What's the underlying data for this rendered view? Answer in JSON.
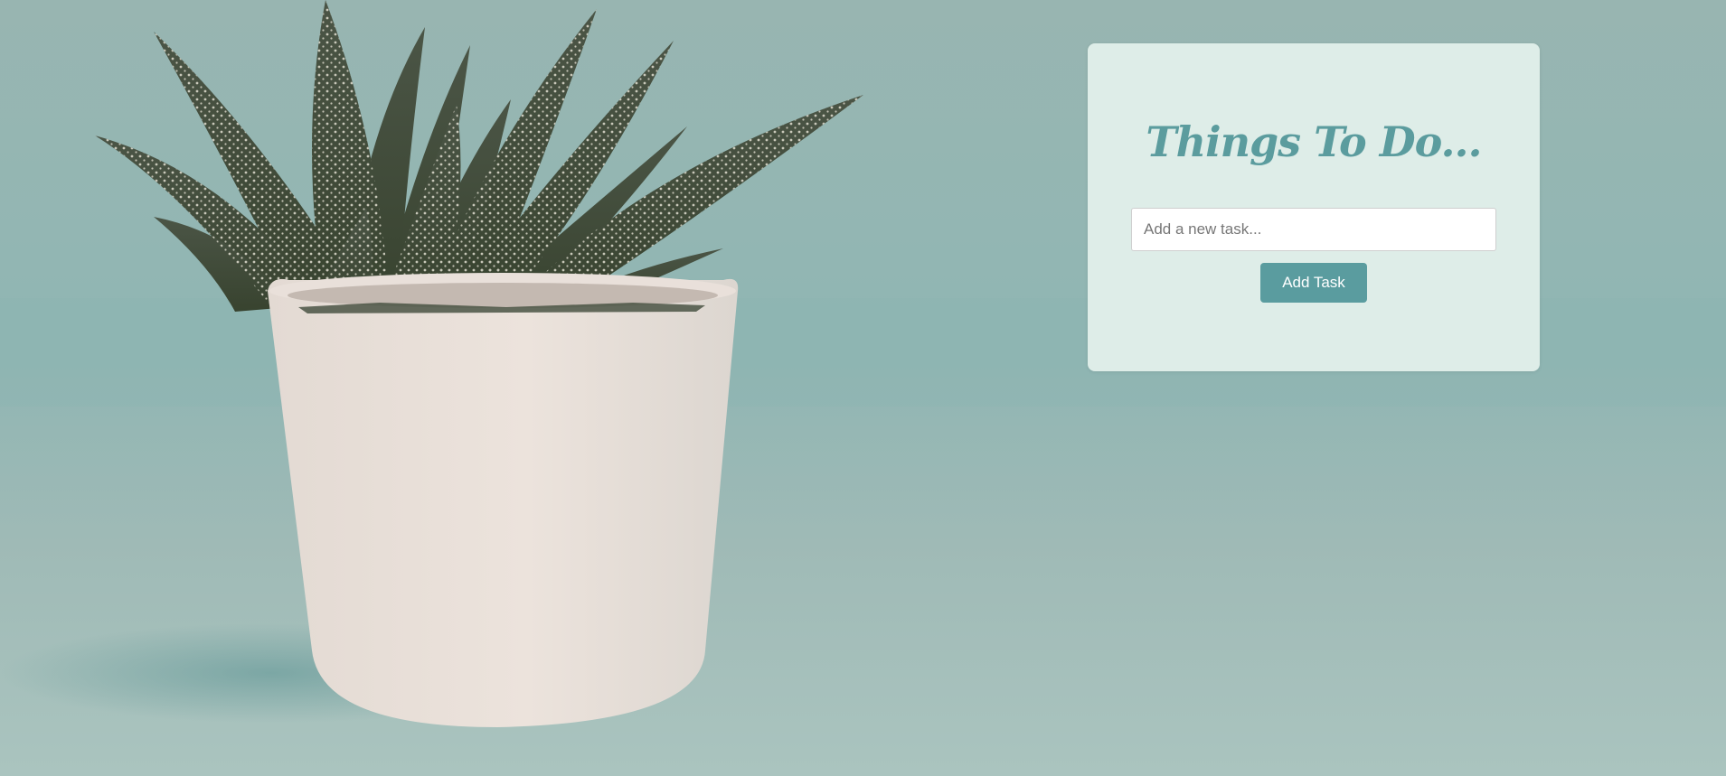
{
  "background": {
    "image": "potted-succulent-plant-photo",
    "colors": {
      "wall": "#95b5b2",
      "pot": "#e6ddd6",
      "leaves": "#3f4a3f"
    }
  },
  "todo_card": {
    "title": "Things To Do...",
    "input": {
      "value": "",
      "placeholder": "Add a new task..."
    },
    "add_button_label": "Add Task",
    "colors": {
      "card_bg": "#deede8",
      "accent": "#5a9c9f"
    }
  }
}
